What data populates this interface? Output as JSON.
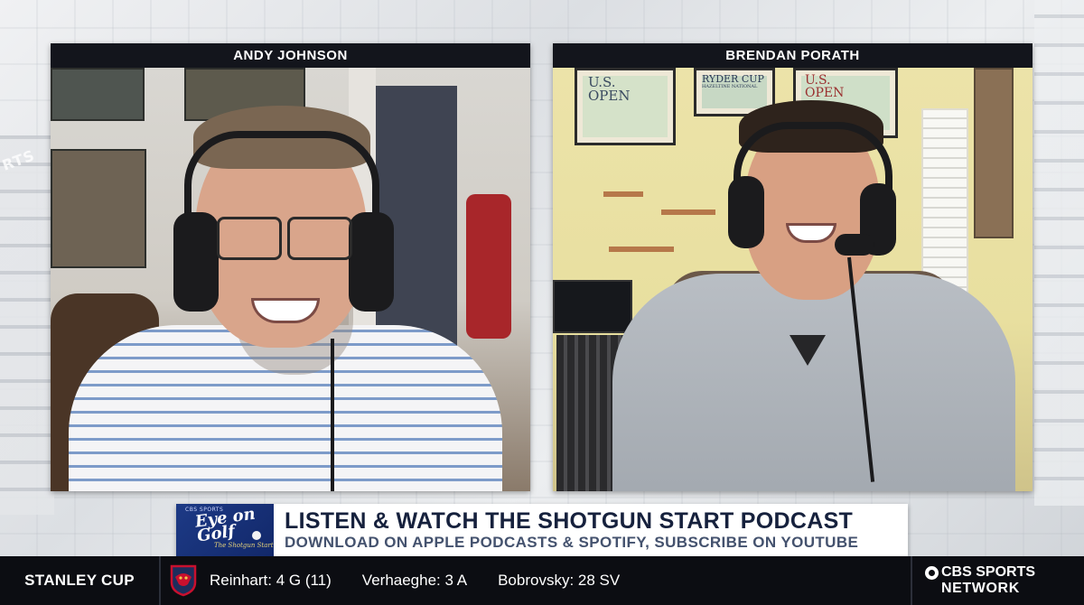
{
  "hosts": {
    "left_name": "ANDY JOHNSON",
    "right_name": "BRENDAN PORATH"
  },
  "posters": [
    {
      "lines": [
        "U.S.",
        "OPEN"
      ]
    },
    {
      "lines": [
        "RYDER CUP",
        "HAZELTINE NATIONAL"
      ]
    },
    {
      "lines": [
        "U.S.",
        "OPEN"
      ]
    }
  ],
  "banner": {
    "logo_top": "CBS SPORTS",
    "logo_main_1": "Eye on",
    "logo_main_2": "Golf",
    "logo_sub": "The Shotgun Start",
    "headline": "LISTEN & WATCH THE SHOTGUN START PODCAST",
    "subline": "DOWNLOAD ON APPLE PODCASTS & SPOTIFY, SUBSCRIBE ON YOUTUBE"
  },
  "ticker": {
    "league": "STANLEY CUP",
    "team_icon": "panthers-icon",
    "items": [
      "Reinhart: 4 G (11)",
      "Verhaeghe: 3 A",
      "Bobrovsky: 28 SV"
    ],
    "network_line1": "CBS SPORTS",
    "network_line2": "NETWORK"
  },
  "colors": {
    "name_bar": "#13151c",
    "banner_headline": "#16213d",
    "banner_logo": "#1d3a86",
    "ticker_bg": "#0c0d12"
  }
}
